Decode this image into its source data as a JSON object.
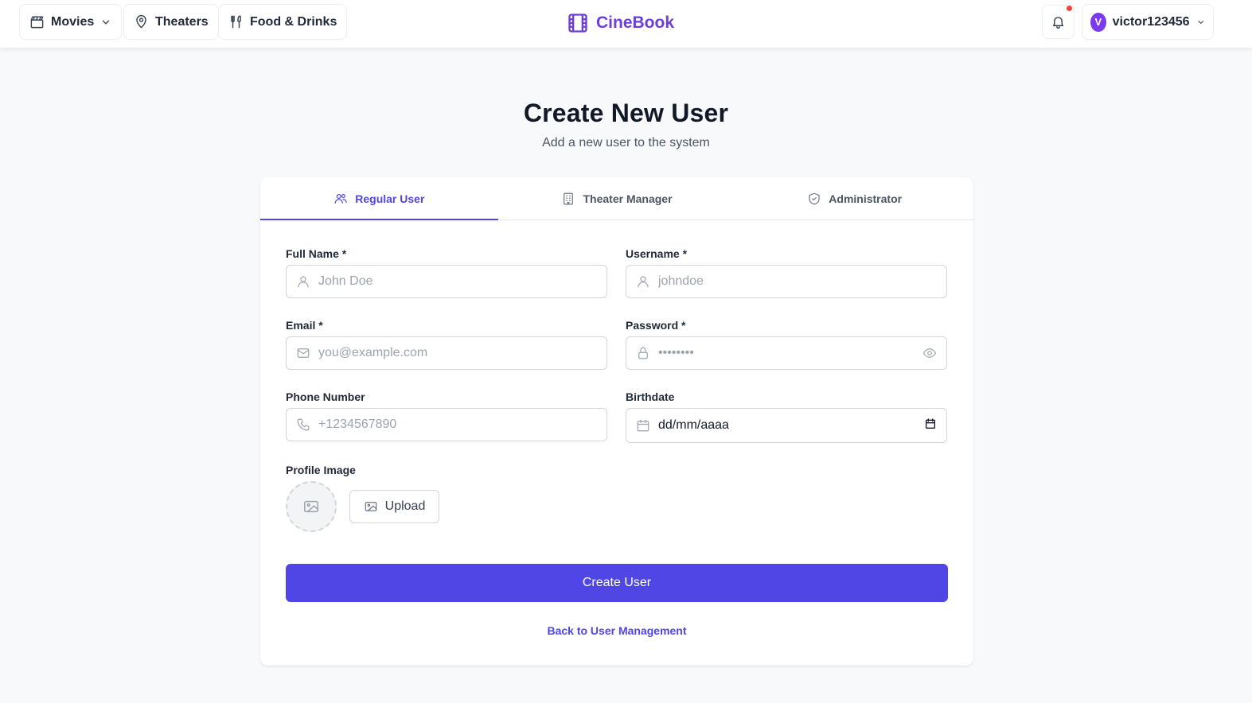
{
  "nav": {
    "movies_label": "Movies",
    "theaters_label": "Theaters",
    "food_label": "Food & Drinks"
  },
  "brand": {
    "name": "CineBook",
    "color": "#6d3fd8"
  },
  "user": {
    "avatar_initial": "V",
    "username": "victor123456"
  },
  "page": {
    "title": "Create New User",
    "subtitle": "Add a new user to the system"
  },
  "tabs": [
    {
      "label": "Regular User",
      "icon": "users-icon",
      "active": true
    },
    {
      "label": "Theater Manager",
      "icon": "building-icon",
      "active": false
    },
    {
      "label": "Administrator",
      "icon": "shield-icon",
      "active": false
    }
  ],
  "form": {
    "full_name": {
      "label": "Full Name *",
      "placeholder": "John Doe",
      "value": ""
    },
    "username": {
      "label": "Username *",
      "placeholder": "johndoe",
      "value": ""
    },
    "email": {
      "label": "Email *",
      "placeholder": "you@example.com",
      "value": ""
    },
    "password": {
      "label": "Password *",
      "placeholder": "••••••••",
      "value": ""
    },
    "phone": {
      "label": "Phone Number",
      "placeholder": "+1234567890",
      "value": ""
    },
    "birthdate": {
      "label": "Birthdate",
      "value": "dd/mm/aaaa"
    },
    "profile_image": {
      "label": "Profile Image",
      "upload_label": "Upload"
    },
    "submit_label": "Create User",
    "back_label": "Back to User Management"
  },
  "colors": {
    "accent": "#4f46e5",
    "notification_dot": "#ef4444",
    "avatar_bg": "#7c3aed"
  }
}
